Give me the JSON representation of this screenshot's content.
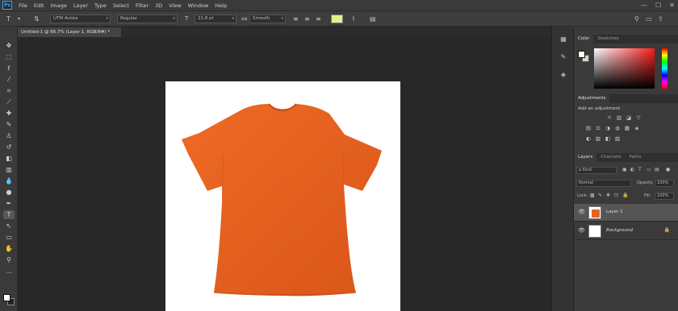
{
  "app": {
    "logo": "Ps"
  },
  "menu": [
    "File",
    "Edit",
    "Image",
    "Layer",
    "Type",
    "Select",
    "Filter",
    "3D",
    "View",
    "Window",
    "Help"
  ],
  "window_controls": {
    "minimize": "—",
    "maximize": "☐",
    "close": "✕"
  },
  "options_bar": {
    "font_family": "UTM Avista",
    "font_style": "Regular",
    "font_size": "21.8 pt",
    "antialias": "Smooth",
    "text_color": "#e4f08a"
  },
  "document": {
    "tab_title": "Untitled-1 @ 66.7% (Layer 1, RGB/8#) *",
    "shirt_color": "#e8611f"
  },
  "panels": {
    "color_tabs": [
      "Color",
      "Swatches"
    ],
    "adjustments_tab": "Adjustments",
    "adjustments_label": "Add an adjustment",
    "adjustments_row1": [
      "☼",
      "▥",
      "◪",
      "▽"
    ],
    "adjustments_row2": [
      "▤",
      "⚖",
      "◑",
      "◍",
      "▦",
      "◈"
    ],
    "adjustments_row3": [
      "◐",
      "▨",
      "◧",
      "▧"
    ],
    "layers_tabs": [
      "Layers",
      "Channels",
      "Paths"
    ],
    "layers_filter": "ρ Kind",
    "blend_mode": "Normal",
    "opacity_label": "Opacity:",
    "opacity_value": "100%",
    "lock_label": "Lock:",
    "fill_label": "Fill:",
    "fill_value": "100%",
    "layers": [
      {
        "name": "Layer 1",
        "selected": true
      },
      {
        "name": "Background",
        "selected": false
      }
    ]
  }
}
